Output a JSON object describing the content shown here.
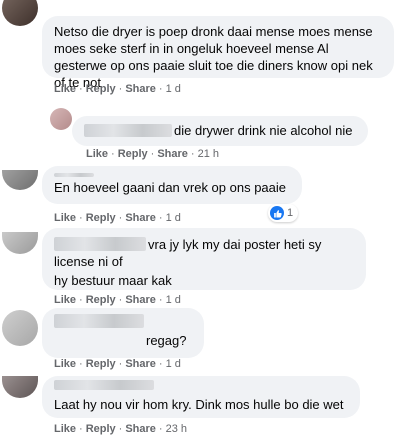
{
  "comments": [
    {
      "text": "Netso die dryer is poep dronk daai mense moes mense moes seke sterf in in ongeluk hoeveel mense Al gesterwe op ons paaie sluit toe die diners know opi nek of te not",
      "like": "Like",
      "reply": "Reply",
      "share": "Share",
      "time": "1 d"
    },
    {
      "text": "die drywer drink nie alcohol nie",
      "like": "Like",
      "reply": "Reply",
      "share": "Share",
      "time": "21 h"
    },
    {
      "text": "En hoeveel gaani dan vrek op ons paaie",
      "like": "Like",
      "reply": "Reply",
      "share": "Share",
      "time": "1 d",
      "reaction_count": "1"
    },
    {
      "text_line1": "vra jy lyk my dai poster heti sy license ni of",
      "text_line2": "hy bestuur maar kak",
      "like": "Like",
      "reply": "Reply",
      "share": "Share",
      "time": "1 d"
    },
    {
      "text": "regag?",
      "like": "Like",
      "reply": "Reply",
      "share": "Share",
      "time": "1 d"
    },
    {
      "text": "Laat hy nou vir hom kry. Dink mos hulle bo die wet",
      "like": "Like",
      "reply": "Reply",
      "share": "Share",
      "time": "23 h"
    }
  ],
  "colors": {
    "bubble": "#f0f2f5",
    "meta": "#65676b",
    "like_blue": "#1877f2"
  },
  "icons": {
    "reaction": "thumbs-up-icon"
  }
}
